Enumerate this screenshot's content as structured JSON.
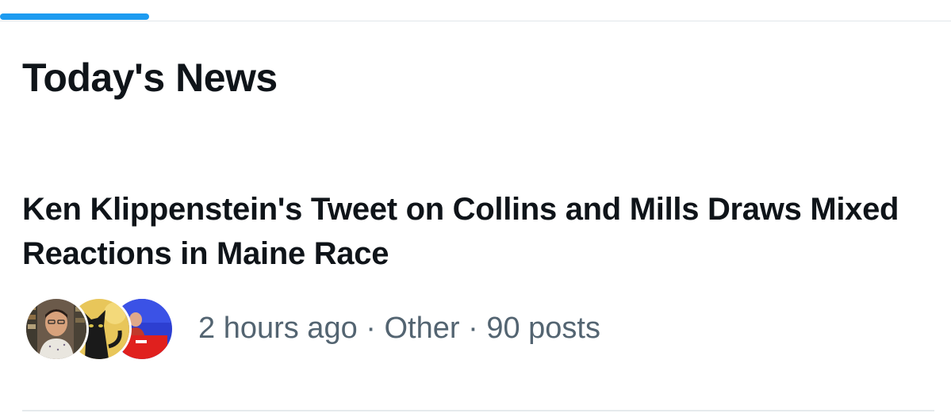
{
  "tabs": {
    "active_indicator_color": "#1d9bf0"
  },
  "section": {
    "title": "Today's News"
  },
  "news_item": {
    "headline": "Ken Klippenstein's Tweet on Collins and Mills Draws Mixed Reactions in Maine Race",
    "time": "2 hours ago",
    "separator": " · ",
    "category": "Other",
    "posts": "90 posts",
    "avatars": [
      "person-avatar",
      "cat-avatar",
      "speaker-avatar"
    ]
  }
}
